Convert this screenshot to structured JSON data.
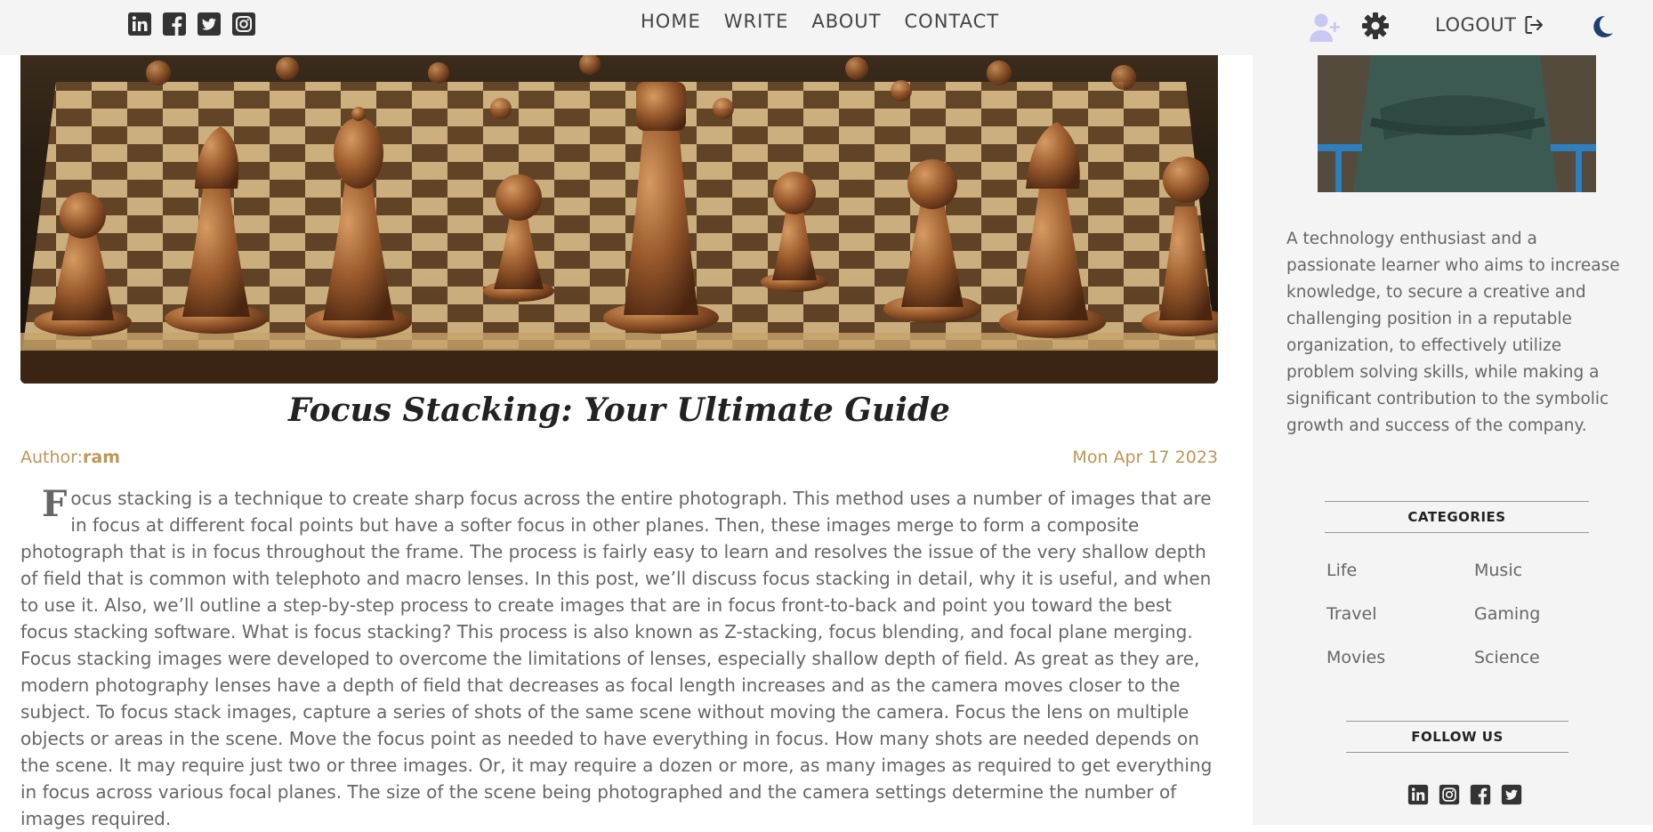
{
  "header": {
    "socials": [
      "linkedin-icon",
      "facebook-icon",
      "twitter-icon",
      "instagram-icon"
    ],
    "nav": [
      "HOME",
      "WRITE",
      "ABOUT",
      "CONTACT"
    ],
    "logout_label": "LOGOUT"
  },
  "post": {
    "title": "Focus Stacking: Your Ultimate Guide",
    "author_label": "Author:",
    "author_name": "ram",
    "date": "Mon Apr 17 2023",
    "dropcap": "F",
    "body": "ocus stacking is a technique to create sharp focus across the entire photograph. This method uses a number of images that are in focus at different focal points but have a softer focus in other planes. Then, these images merge to form a composite photograph that is in focus throughout the frame. The process is fairly easy to learn and resolves the issue of the very shallow depth of field that is common with telephoto and macro lenses. In this post, we’ll discuss focus stacking in detail, why it is useful, and when to use it. Also, we’ll outline a step-by-step process to create images that are in focus front-to-back and point you toward the best focus stacking software. What is focus stacking? This process is also known as Z-stacking, focus blending, and focal plane merging. Focus stacking images were developed to overcome the limitations of lenses, especially shallow depth of field. As great as they are, modern photography lenses have a depth of field that decreases as focal length increases and as the camera moves closer to the subject. To focus stack images, capture a series of shots of the same scene without moving the camera. Focus the lens on multiple objects or areas in the scene. Move the focus point as needed to have everything in focus. How many shots are needed depends on the scene. It may require just two or three images. Or, it may require a dozen or more, as many images as required to get everything in focus across various focal planes. The size of the scene being photographed and the camera settings determine the number of images required."
  },
  "sidebar": {
    "about": "A technology enthusiast and a passionate learner who aims to increase knowledge, to secure a creative and challenging position in a reputable organization, to effectively utilize problem solving skills, while making a significant contribution to the symbolic growth and success of the company.",
    "categories_title": "CATEGORIES",
    "categories": [
      "Life",
      "Music",
      "Travel",
      "Gaming",
      "Movies",
      "Science"
    ],
    "follow_title": "FOLLOW US",
    "follow_icons": [
      "linkedin-icon",
      "instagram-icon",
      "facebook-icon",
      "twitter-icon"
    ]
  },
  "colors": {
    "accent": "#be9656",
    "moon": "#1f3f6e",
    "user_add": "#c9c8f0",
    "topbar": "#f4f4f4"
  }
}
